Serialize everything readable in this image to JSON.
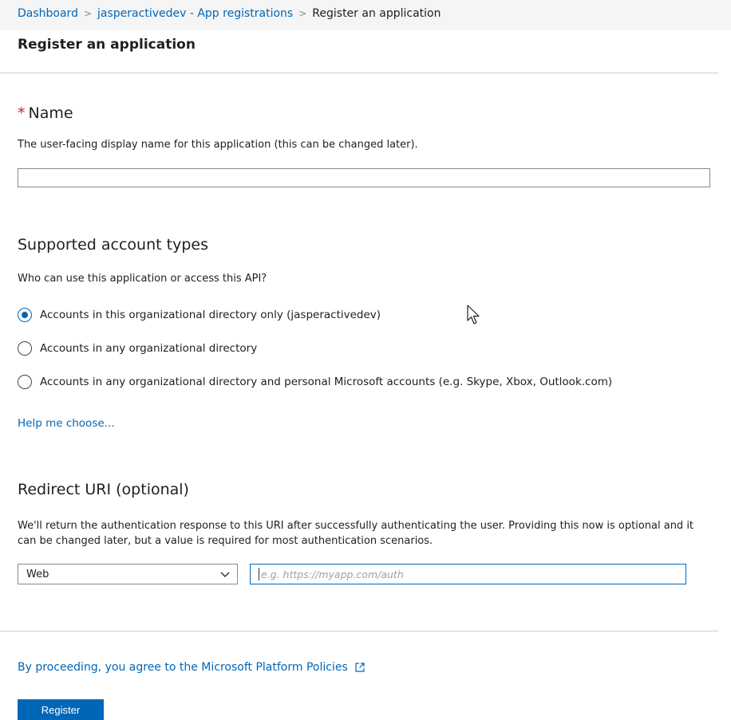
{
  "breadcrumb": {
    "items": [
      "Dashboard",
      "jasperactivedev - App registrations"
    ],
    "current": "Register an application",
    "separator": ">"
  },
  "page_title": "Register an application",
  "name_section": {
    "required_mark": "*",
    "title": "Name",
    "description": "The user-facing display name for this application (this can be changed later).",
    "value": ""
  },
  "account_types": {
    "title": "Supported account types",
    "description": "Who can use this application or access this API?",
    "options": [
      {
        "label": "Accounts in this organizational directory only (jasperactivedev)",
        "selected": true
      },
      {
        "label": "Accounts in any organizational directory",
        "selected": false
      },
      {
        "label": "Accounts in any organizational directory and personal Microsoft accounts (e.g. Skype, Xbox, Outlook.com)",
        "selected": false
      }
    ],
    "help_link": "Help me choose..."
  },
  "redirect": {
    "title": "Redirect URI (optional)",
    "description": "We'll return the authentication response to this URI after successfully authenticating the user. Providing this now is optional and it can be changed later, but a value is required for most authentication scenarios.",
    "platform_selected": "Web",
    "uri_placeholder": "e.g. https://myapp.com/auth",
    "uri_value": ""
  },
  "footer": {
    "policy_text": "By proceeding, you agree to the Microsoft Platform Policies",
    "register_label": "Register"
  },
  "colors": {
    "accent": "#0067b8",
    "required": "#c4262e"
  },
  "icons": {
    "select_arrow": "chevron-down-icon",
    "policy_link": "external-link-icon",
    "pointer": "mouse-cursor-icon"
  }
}
